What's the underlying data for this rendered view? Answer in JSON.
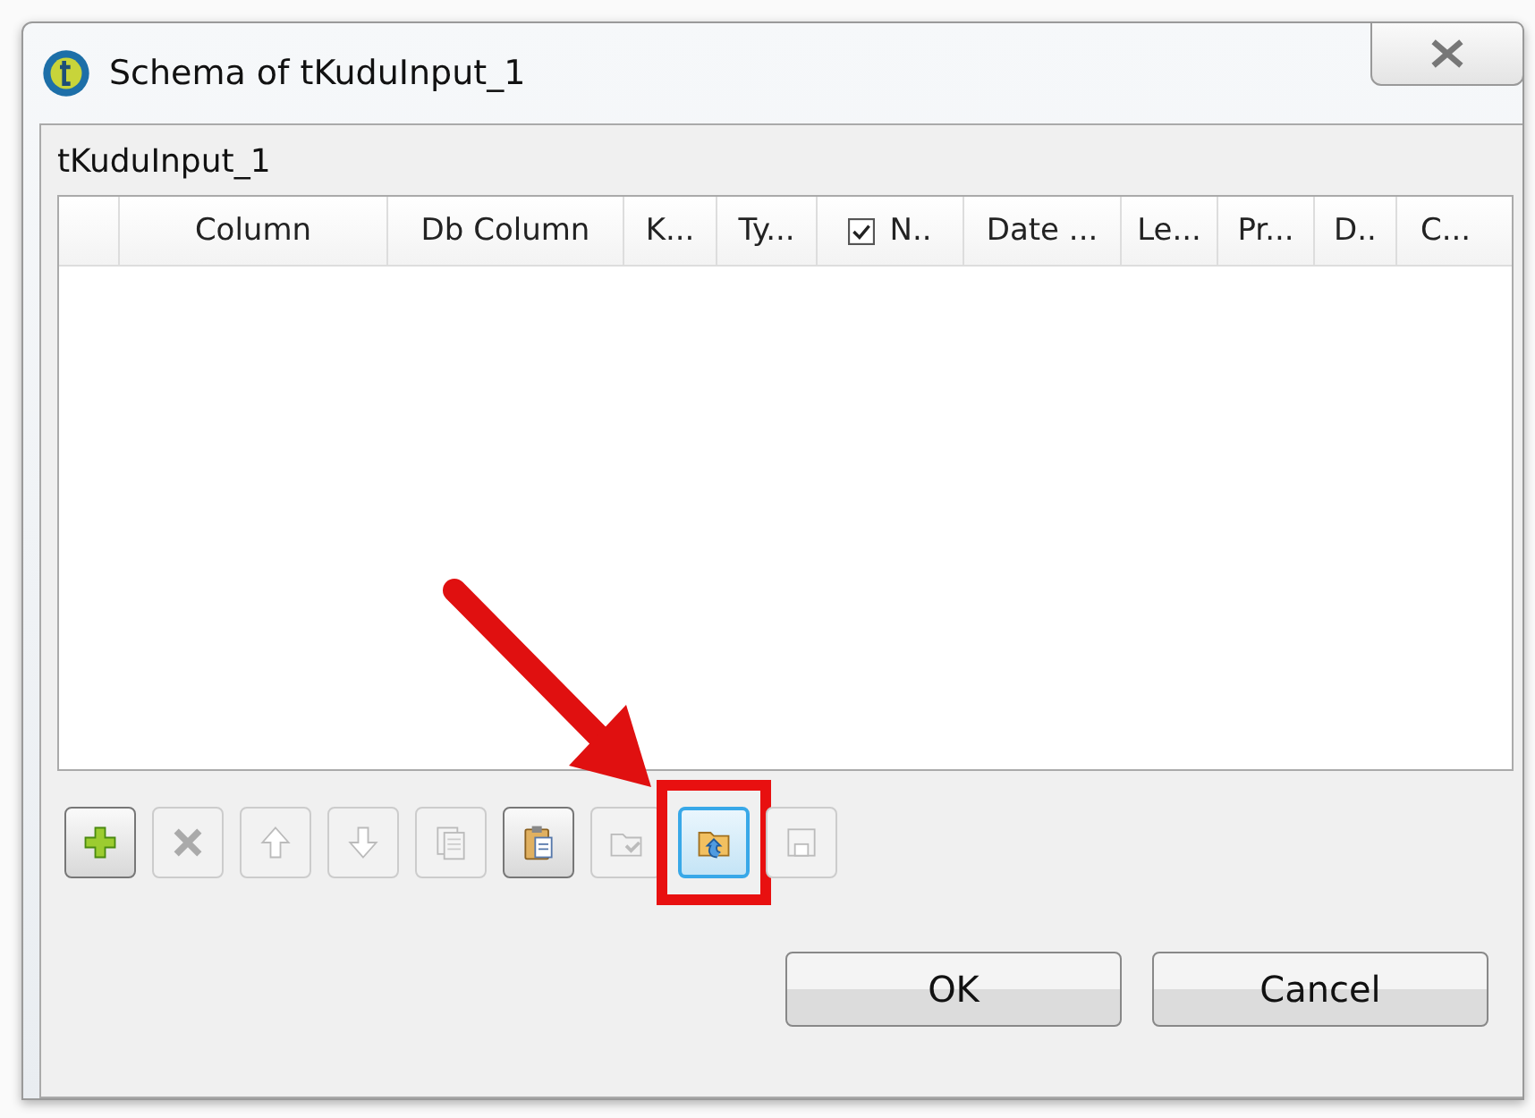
{
  "window": {
    "title": "Schema of tKuduInput_1"
  },
  "schema_label": "tKuduInput_1",
  "table": {
    "columns": [
      {
        "kind": "text",
        "label": "Column"
      },
      {
        "kind": "text",
        "label": "Db Column"
      },
      {
        "kind": "text",
        "label": "K..."
      },
      {
        "kind": "text",
        "label": "Ty..."
      },
      {
        "kind": "check",
        "checked": true,
        "label": "N.."
      },
      {
        "kind": "text",
        "label": "Date ..."
      },
      {
        "kind": "text",
        "label": "Le..."
      },
      {
        "kind": "text",
        "label": "Pr..."
      },
      {
        "kind": "text",
        "label": "D.."
      },
      {
        "kind": "text",
        "label": "C..."
      }
    ]
  },
  "toolbar": [
    {
      "kind": "add",
      "disabled": false,
      "focused": false,
      "highlighted": false
    },
    {
      "kind": "delete",
      "disabled": true,
      "focused": false,
      "highlighted": false
    },
    {
      "kind": "up",
      "disabled": true,
      "focused": false,
      "highlighted": false
    },
    {
      "kind": "down",
      "disabled": true,
      "focused": false,
      "highlighted": false
    },
    {
      "kind": "copy",
      "disabled": true,
      "focused": false,
      "highlighted": false
    },
    {
      "kind": "paste",
      "disabled": false,
      "focused": false,
      "highlighted": false
    },
    {
      "kind": "import",
      "disabled": true,
      "focused": false,
      "highlighted": false
    },
    {
      "kind": "export",
      "disabled": false,
      "focused": true,
      "highlighted": true
    },
    {
      "kind": "save",
      "disabled": true,
      "focused": false,
      "highlighted": false
    }
  ],
  "buttons": [
    "OK",
    "Cancel"
  ]
}
